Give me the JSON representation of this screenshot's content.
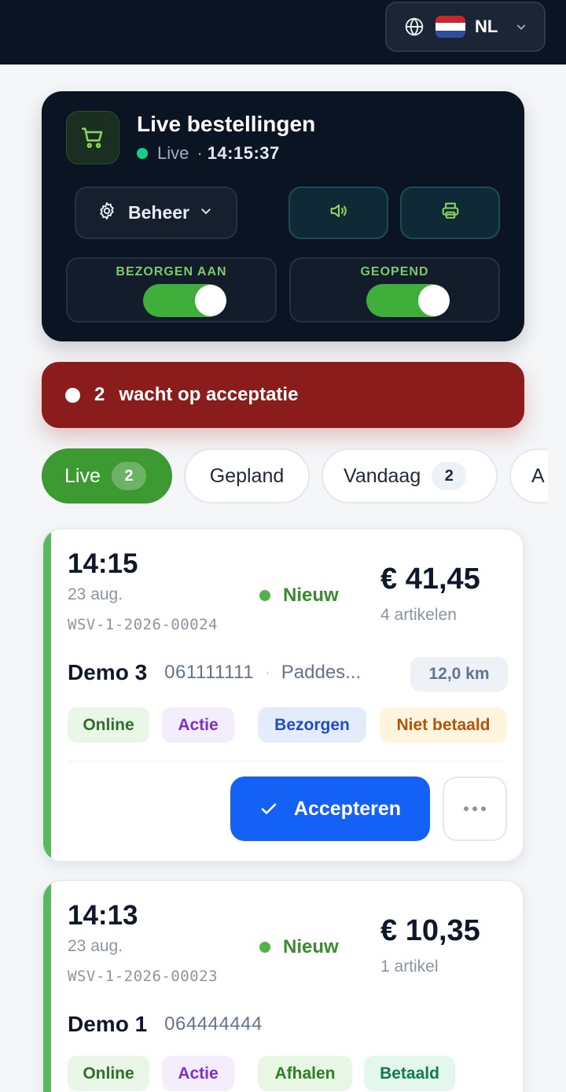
{
  "topbar": {
    "language_code": "NL"
  },
  "live_panel": {
    "title": "Live bestellingen",
    "status": "Live",
    "separator": "·",
    "time": "14:15:37",
    "manage_label": "Beheer",
    "toggles": [
      {
        "label": "BEZORGEN AAN",
        "on": true
      },
      {
        "label": "GEOPEND",
        "on": true
      }
    ]
  },
  "alert": {
    "count": "2",
    "text": "wacht op acceptatie"
  },
  "tabs": [
    {
      "label": "Live",
      "count": "2",
      "active": true
    },
    {
      "label": "Gepland",
      "count": null,
      "active": false
    },
    {
      "label": "Vandaag",
      "count": "2",
      "active": false
    },
    {
      "label": "A",
      "count": null,
      "active": false
    }
  ],
  "orders": [
    {
      "time": "14:15",
      "date": "23 aug.",
      "id": "WSV-1-2026-00024",
      "status": "Nieuw",
      "price": "€ 41,45",
      "items": "4 artikelen",
      "customer": "Demo 3",
      "phone": "061111111",
      "separator": "·",
      "address": "Paddes...",
      "distance": "12,0 km",
      "chips": [
        "Online",
        "Actie",
        "Bezorgen",
        "Niet betaald"
      ],
      "accept_label": "Accepteren"
    },
    {
      "time": "14:13",
      "date": "23 aug.",
      "id": "WSV-1-2026-00023",
      "status": "Nieuw",
      "price": "€ 10,35",
      "items": "1 artikel",
      "customer": "Demo 1",
      "phone": "064444444",
      "chips": [
        "Online",
        "Actie",
        "Afhalen",
        "Betaald"
      ]
    }
  ],
  "colors": {
    "accent_green": "#3d9a32",
    "alert_red": "#8a1d1b",
    "accept_blue": "#1462f5",
    "panel_dark": "#0b1422"
  }
}
